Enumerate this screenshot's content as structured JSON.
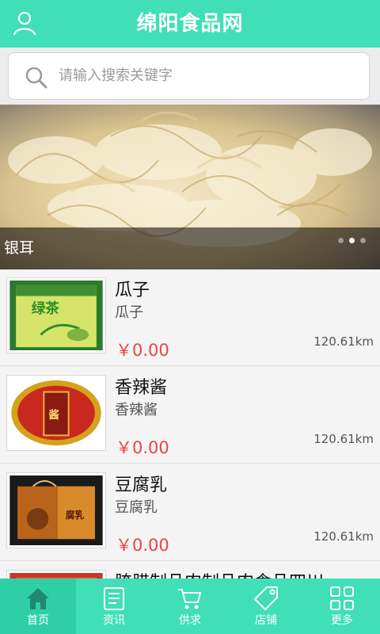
{
  "header": {
    "title": "绵阳食品网",
    "user_icon": "user-icon"
  },
  "search": {
    "placeholder": "请输入搜索关键字",
    "icon": "search-icon"
  },
  "banner": {
    "caption": "银耳",
    "slide_count": 3,
    "active_slide": 2
  },
  "products": [
    {
      "name": "瓜子",
      "subtitle": "瓜子",
      "price": "￥0.00",
      "distance": "120.61km"
    },
    {
      "name": "香辣酱",
      "subtitle": "香辣酱",
      "price": "￥0.00",
      "distance": "120.61km"
    },
    {
      "name": "豆腐乳",
      "subtitle": "豆腐乳",
      "price": "￥0.00",
      "distance": "120.61km"
    },
    {
      "name": "腌腊制品肉制品肉食品四川",
      "subtitle": "",
      "price": "",
      "distance": ""
    }
  ],
  "tabbar": {
    "items": [
      {
        "label": "首页",
        "icon": "home-icon",
        "active": true
      },
      {
        "label": "资讯",
        "icon": "news-icon",
        "active": false
      },
      {
        "label": "供求",
        "icon": "cart-icon",
        "active": false
      },
      {
        "label": "店铺",
        "icon": "tag-icon",
        "active": false
      },
      {
        "label": "更多",
        "icon": "grid-icon",
        "active": false
      }
    ]
  },
  "colors": {
    "accent": "#40dfb6",
    "price": "#e64545"
  }
}
